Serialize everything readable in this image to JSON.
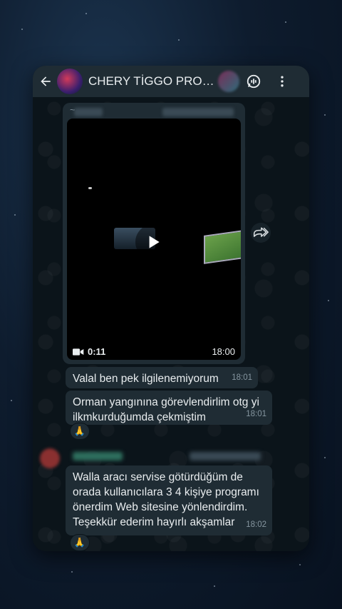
{
  "header": {
    "back_icon": "arrow-left-icon",
    "title": "CHERY TİGGO PRO M...",
    "voice_chat_icon": "voice-chat-icon",
    "menu_icon": "more-vertical-icon"
  },
  "video_message": {
    "sender_prefix": "~",
    "duration": "0:11",
    "time": "18:00",
    "play_icon": "play-icon",
    "camera_icon": "video-camera-icon"
  },
  "forward_icon": "forward-icon",
  "messages": [
    {
      "text": "Valal ben pek ilgilenemiyorum",
      "time": "18:01"
    },
    {
      "text": "Orman yangınına görevlendirlim otg yi ilkmkurduğumda çekmiştim",
      "time": "18:01",
      "reaction": "🙏"
    },
    {
      "text": "Walla aracı servise götürdüğüm de orada kullanıcılara 3 4 kişiye programı önerdim Web sitesine yönlendirdim. Teşekkür ederim hayırlı akşamlar",
      "time": "18:02",
      "reaction": "🙏"
    }
  ],
  "colors": {
    "header_bg": "#1f2c34",
    "chat_bg": "#0b141a",
    "bubble_bg": "#1f2c34",
    "text": "#e9edef",
    "meta": "#8696a0"
  }
}
